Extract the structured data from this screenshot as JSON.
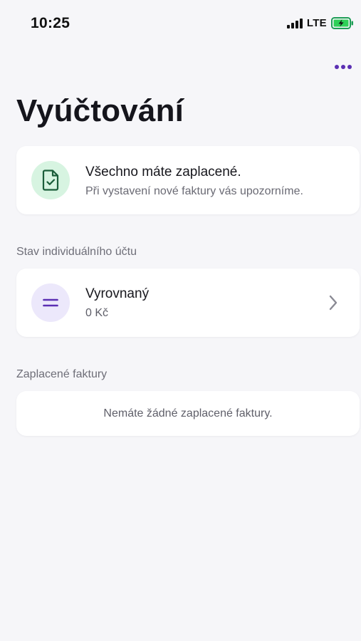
{
  "status_bar": {
    "time": "10:25",
    "network": "LTE"
  },
  "header": {
    "title": "Vyúčtování",
    "more_icon": "more-dots-icon"
  },
  "payment_status": {
    "icon": "document-check-icon",
    "title": "Všechno máte zaplacené.",
    "subtitle": "Při vystavení nové faktury vás upozorníme."
  },
  "account_section": {
    "label": "Stav individuálního účtu",
    "status": "Vyrovnaný",
    "amount": "0 Kč",
    "icon": "equals-icon"
  },
  "invoices_section": {
    "label": "Zaplacené faktury",
    "empty_text": "Nemáte žádné zaplacené faktury."
  },
  "colors": {
    "accent": "#5b2fb3",
    "success": "#1f9e57",
    "background": "#f6f6f9"
  }
}
